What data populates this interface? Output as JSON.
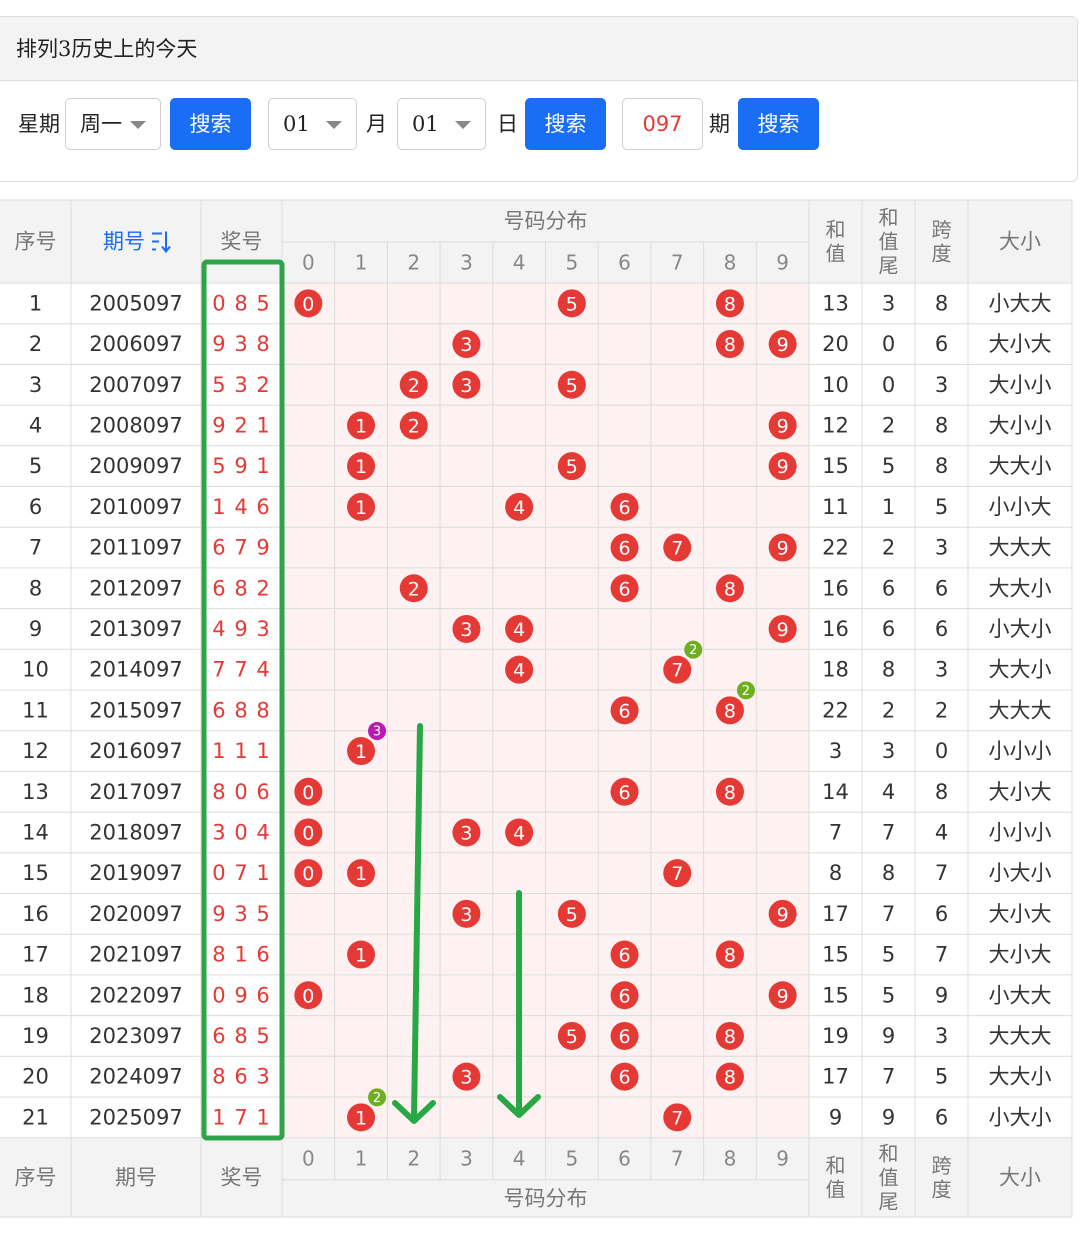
{
  "header": {
    "title": "排列3历史上的今天"
  },
  "filters": {
    "weekday_label": "星期",
    "weekday_value": "周一",
    "search_label": "搜索",
    "month_value": "01",
    "month_label": "月",
    "day_value": "01",
    "day_label": "日",
    "issue_value": "097",
    "issue_label": "期"
  },
  "table": {
    "head": {
      "seq": "序号",
      "period": "期号",
      "sort_icon": "sort-icon",
      "prize": "奖号",
      "dist": "号码分布",
      "digits": [
        "0",
        "1",
        "2",
        "3",
        "4",
        "5",
        "6",
        "7",
        "8",
        "9"
      ],
      "sum": "和值",
      "sum_tail": "和值尾",
      "span": "跨度",
      "size": "大小"
    },
    "foot": {
      "seq": "序号",
      "period": "期号",
      "prize": "奖号"
    },
    "rows": [
      {
        "seq": "1",
        "period": "2005097",
        "prize": "0 8 5",
        "sum": "13",
        "tail": "3",
        "span": "8",
        "size": "小大大"
      },
      {
        "seq": "2",
        "period": "2006097",
        "prize": "9 3 8",
        "sum": "20",
        "tail": "0",
        "span": "6",
        "size": "大小大"
      },
      {
        "seq": "3",
        "period": "2007097",
        "prize": "5 3 2",
        "sum": "10",
        "tail": "0",
        "span": "3",
        "size": "大小小"
      },
      {
        "seq": "4",
        "period": "2008097",
        "prize": "9 2 1",
        "sum": "12",
        "tail": "2",
        "span": "8",
        "size": "大小小"
      },
      {
        "seq": "5",
        "period": "2009097",
        "prize": "5 9 1",
        "sum": "15",
        "tail": "5",
        "span": "8",
        "size": "大大小"
      },
      {
        "seq": "6",
        "period": "2010097",
        "prize": "1 4 6",
        "sum": "11",
        "tail": "1",
        "span": "5",
        "size": "小小大"
      },
      {
        "seq": "7",
        "period": "2011097",
        "prize": "6 7 9",
        "sum": "22",
        "tail": "2",
        "span": "3",
        "size": "大大大"
      },
      {
        "seq": "8",
        "period": "2012097",
        "prize": "6 8 2",
        "sum": "16",
        "tail": "6",
        "span": "6",
        "size": "大大小"
      },
      {
        "seq": "9",
        "period": "2013097",
        "prize": "4 9 3",
        "sum": "16",
        "tail": "6",
        "span": "6",
        "size": "小大小"
      },
      {
        "seq": "10",
        "period": "2014097",
        "prize": "7 7 4",
        "sum": "18",
        "tail": "8",
        "span": "3",
        "size": "大大小"
      },
      {
        "seq": "11",
        "period": "2015097",
        "prize": "6 8 8",
        "sum": "22",
        "tail": "2",
        "span": "2",
        "size": "大大大"
      },
      {
        "seq": "12",
        "period": "2016097",
        "prize": "1 1 1",
        "sum": "3",
        "tail": "3",
        "span": "0",
        "size": "小小小"
      },
      {
        "seq": "13",
        "period": "2017097",
        "prize": "8 0 6",
        "sum": "14",
        "tail": "4",
        "span": "8",
        "size": "大小大"
      },
      {
        "seq": "14",
        "period": "2018097",
        "prize": "3 0 4",
        "sum": "7",
        "tail": "7",
        "span": "4",
        "size": "小小小"
      },
      {
        "seq": "15",
        "period": "2019097",
        "prize": "0 7 1",
        "sum": "8",
        "tail": "8",
        "span": "7",
        "size": "小大小"
      },
      {
        "seq": "16",
        "period": "2020097",
        "prize": "9 3 5",
        "sum": "17",
        "tail": "7",
        "span": "6",
        "size": "大小大"
      },
      {
        "seq": "17",
        "period": "2021097",
        "prize": "8 1 6",
        "sum": "15",
        "tail": "5",
        "span": "7",
        "size": "大小大"
      },
      {
        "seq": "18",
        "period": "2022097",
        "prize": "0 9 6",
        "sum": "15",
        "tail": "5",
        "span": "9",
        "size": "小大大"
      },
      {
        "seq": "19",
        "period": "2023097",
        "prize": "6 8 5",
        "sum": "19",
        "tail": "9",
        "span": "3",
        "size": "大大大"
      },
      {
        "seq": "20",
        "period": "2024097",
        "prize": "8 6 3",
        "sum": "17",
        "tail": "7",
        "span": "5",
        "size": "大大小"
      },
      {
        "seq": "21",
        "period": "2025097",
        "prize": "1 7 1",
        "sum": "9",
        "tail": "9",
        "span": "6",
        "size": "小大小"
      }
    ],
    "repeat_badges": [
      {
        "row": "10",
        "digit": "7",
        "count": "2"
      },
      {
        "row": "11",
        "digit": "8",
        "count": "2"
      },
      {
        "row": "12",
        "digit": "1",
        "count": "3"
      },
      {
        "row": "21",
        "digit": "1",
        "count": "2"
      }
    ]
  },
  "colors": {
    "ball": "#e53935",
    "badge_green": "#6fae1e",
    "badge_purple": "#b81ab2",
    "highlight_box": "#2fa34a",
    "arrow": "#27a844",
    "link_blue": "#1a6ef5",
    "dist_bg": "#fdf1f1"
  },
  "annotations": [
    "green-box-prize-column",
    "arrow-column-2",
    "arrow-column-4"
  ]
}
